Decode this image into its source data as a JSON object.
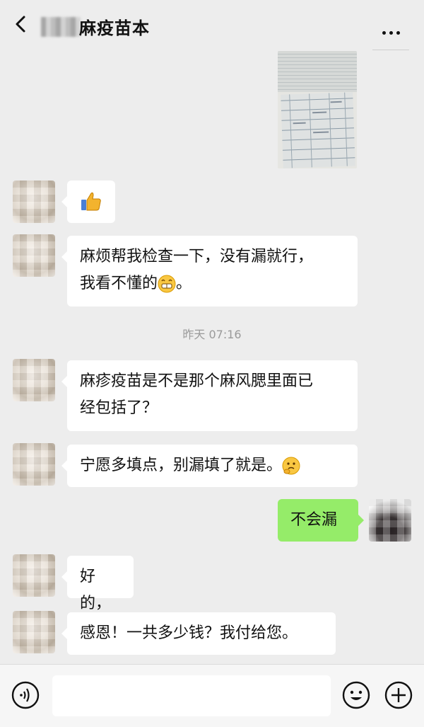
{
  "header": {
    "title": "麻疫苗本",
    "back_icon": "chevron-left-icon",
    "more_icon": "more-horizontal-icon"
  },
  "messages": [
    {
      "side": "right",
      "type": "image",
      "content": "photo of vaccination record"
    },
    {
      "side": "left",
      "type": "emoji",
      "emoji": "thumbs-up-icon"
    },
    {
      "side": "left",
      "line1": "麻烦帮我检查一下，没有漏就行，",
      "line2": "我看不懂的",
      "emoji": "grin-icon",
      "line2_end": "。"
    },
    {
      "side": "left",
      "line1": "麻疹疫苗是不是那个麻风腮里面已",
      "line2": "经包括了？"
    },
    {
      "side": "left",
      "line1": "宁愿多填点，别漏填了就是。",
      "emoji": "thinking-icon"
    },
    {
      "side": "right",
      "line1": "不会漏"
    },
    {
      "side": "left",
      "line1": "好的，"
    },
    {
      "side": "left",
      "line1": "感恩！一共多少钱？我付给您。"
    }
  ],
  "timestamp": "昨天 07:16",
  "input_bar": {
    "voice_icon": "voice-icon",
    "emoji_icon": "smiley-icon",
    "add_icon": "plus-circle-icon"
  },
  "colors": {
    "background": "#ededed",
    "bubble_left": "#ffffff",
    "bubble_right": "#95ec69",
    "timestamp": "#9a9a9a"
  }
}
